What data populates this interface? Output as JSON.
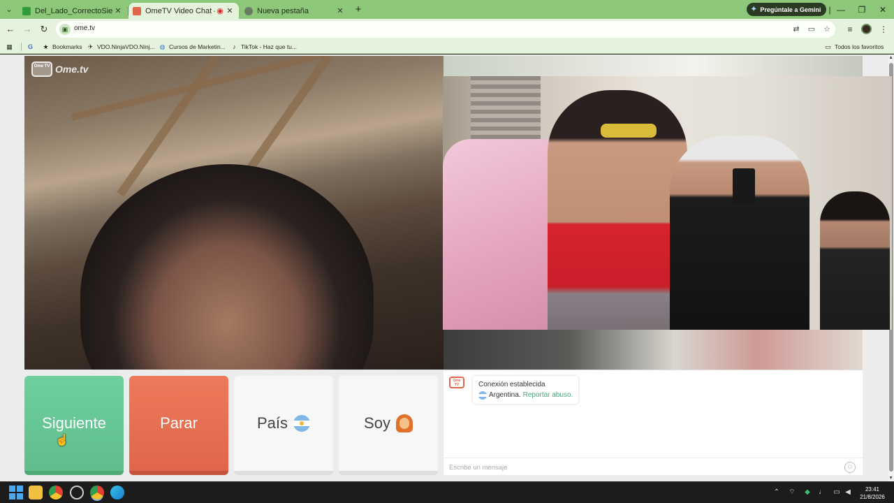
{
  "browser": {
    "tabs": [
      {
        "title": "Del_Lado_CorrectoSiempre Stre",
        "favicon_color": "#2e9d3a",
        "active": false
      },
      {
        "title": "OmeTV Video Chat — Ome",
        "favicon_color": "#e0664a",
        "active": true
      },
      {
        "title": "Nueva pestaña",
        "favicon_color": "#6a7a64",
        "active": false
      }
    ],
    "new_tab_symbol": "+",
    "gemini_label": "Pregúntale a Gemini",
    "url": "ome.tv",
    "bookmarks": [
      {
        "label": "Bookmarks",
        "icon": "star-icon"
      },
      {
        "label": "VDO.NinjaVDO.Ninj...",
        "icon": "ninja-icon"
      },
      {
        "label": "Cursos de Marketin...",
        "icon": "globe-icon"
      },
      {
        "label": "TikTok - Haz que tu...",
        "icon": "tiktok-icon"
      }
    ],
    "all_bookmarks_label": "Todos los favoritos"
  },
  "site": {
    "brand_tv": "Ome TV",
    "brand_name": "Ome.tv",
    "buttons": {
      "next": "Siguiente",
      "stop": "Parar",
      "country": "País",
      "gender": "Soy"
    },
    "chat": {
      "logo_text": "Ome TV",
      "status": "Conexión establecida",
      "country": "Argentina.",
      "report": "Reportar abuso.",
      "input_placeholder": "Escribe un mensaje"
    }
  },
  "taskbar": {
    "time": "23:41",
    "date": "21/8/2026"
  },
  "colors": {
    "next": "#5fbe8b",
    "stop": "#e0664a",
    "chrome_frame": "#8dc87a",
    "toolbar": "#e5f2dd"
  }
}
